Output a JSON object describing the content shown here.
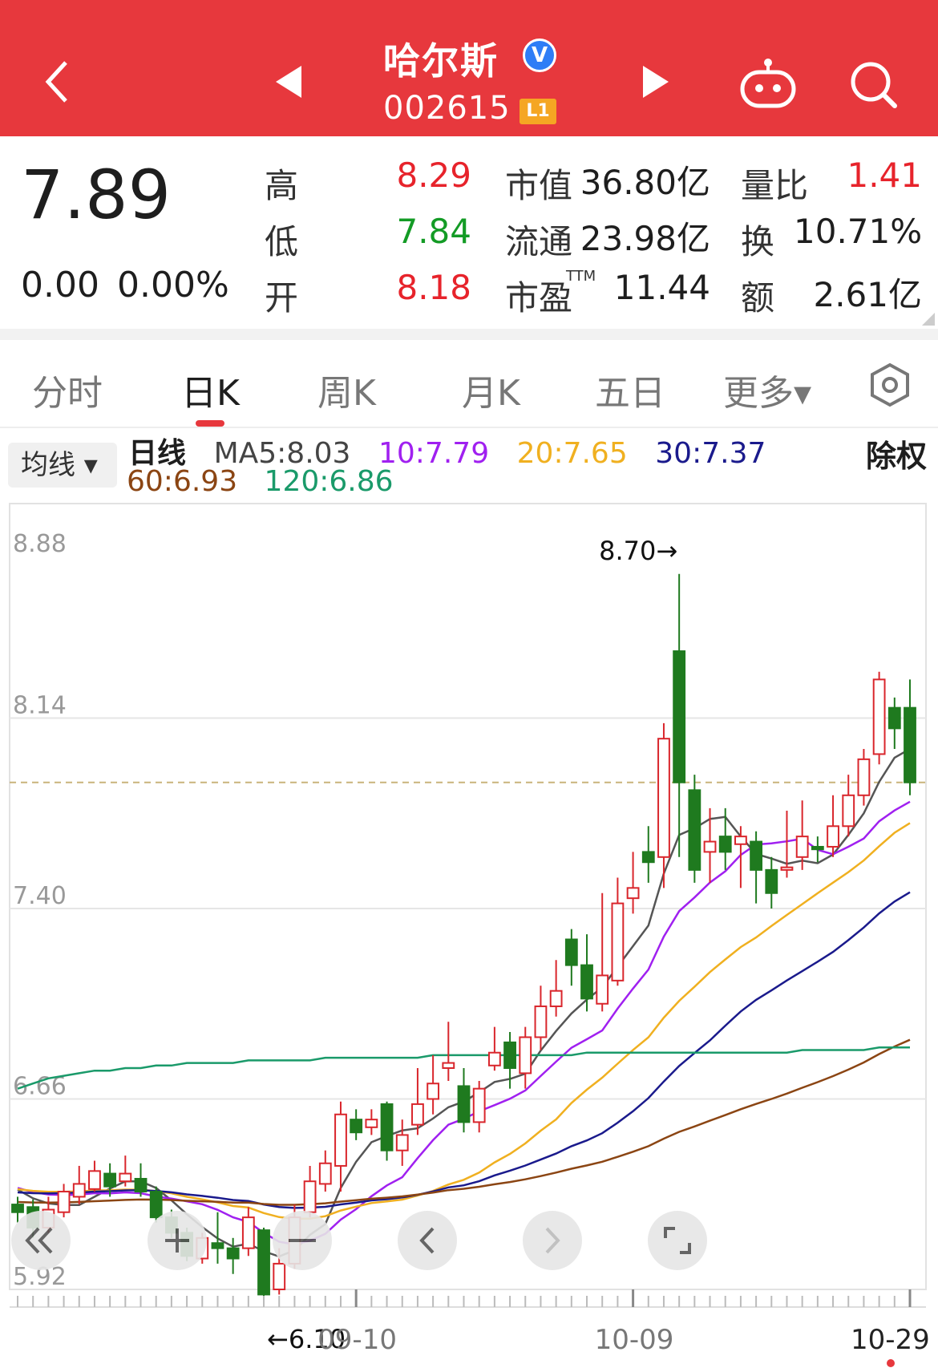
{
  "header": {
    "stock_name": "哈尔斯",
    "stock_code": "002615",
    "level_badge": "L1",
    "verified_badge": "V",
    "icons": [
      "back-icon",
      "prev-stock-icon",
      "next-stock-icon",
      "robot-icon",
      "search-icon"
    ]
  },
  "quote": {
    "price": "7.89",
    "change": "0.00",
    "change_pct": "0.00%",
    "rows": [
      [
        {
          "label": "高",
          "value": "8.29",
          "color": "red"
        },
        {
          "label": "市值",
          "value": "36.80亿",
          "color": "dark"
        },
        {
          "label": "量比",
          "value": "1.41",
          "color": "red"
        }
      ],
      [
        {
          "label": "低",
          "value": "7.84",
          "color": "green"
        },
        {
          "label": "流通",
          "value": "23.98亿",
          "color": "dark"
        },
        {
          "label": "换",
          "value": "10.71%",
          "color": "dark"
        }
      ],
      [
        {
          "label": "开",
          "value": "8.18",
          "color": "red"
        },
        {
          "label": "市盈",
          "value": "11.44",
          "color": "dark"
        },
        {
          "label": "额",
          "value": "2.61亿",
          "color": "dark"
        }
      ]
    ],
    "ttm": "TTM"
  },
  "tabs": [
    "分时",
    "日K",
    "周K",
    "月K",
    "五日",
    "更多▾"
  ],
  "active_tab": 1,
  "ma_selector": "均线 ▾",
  "ma_legend": {
    "row1": [
      {
        "text": "日线",
        "color": "#1e1e1e"
      },
      {
        "text": "MA5:8.03",
        "color": "#444444"
      },
      {
        "text": "10:7.79",
        "color": "#a020f0"
      },
      {
        "text": "20:7.65",
        "color": "#f0b020"
      },
      {
        "text": "30:7.37",
        "color": "#1a1a8c"
      }
    ],
    "row2": [
      {
        "text": "60:6.93",
        "color": "#8b4513"
      },
      {
        "text": "120:6.86",
        "color": "#1a9a6a"
      }
    ]
  },
  "chuquan": "除权",
  "chart_data": {
    "type": "candlestick",
    "y_axis_labels": [
      "8.88",
      "8.14",
      "7.40",
      "6.66",
      "5.92"
    ],
    "ylim": [
      5.92,
      8.88
    ],
    "x_labels": [
      "09-10",
      "10-09",
      "10-29"
    ],
    "high_annotation": "8.70→",
    "low_annotation": "←6.10",
    "last_price_line": 7.89,
    "colors": {
      "up": "#d9262c",
      "down": "#1f7a1f"
    },
    "candles": [
      [
        6.25,
        6.22,
        6.28,
        6.18
      ],
      [
        6.24,
        6.16,
        6.27,
        6.12
      ],
      [
        6.16,
        6.23,
        6.28,
        6.14
      ],
      [
        6.22,
        6.3,
        6.33,
        6.2
      ],
      [
        6.28,
        6.33,
        6.4,
        6.25
      ],
      [
        6.31,
        6.38,
        6.42,
        6.3
      ],
      [
        6.37,
        6.32,
        6.41,
        6.28
      ],
      [
        6.34,
        6.37,
        6.44,
        6.32
      ],
      [
        6.35,
        6.3,
        6.41,
        6.28
      ],
      [
        6.3,
        6.2,
        6.32,
        6.18
      ],
      [
        6.2,
        6.14,
        6.23,
        6.12
      ],
      [
        6.14,
        6.05,
        6.16,
        6.03
      ],
      [
        6.04,
        6.12,
        6.14,
        6.02
      ],
      [
        6.1,
        6.08,
        6.22,
        6.02
      ],
      [
        6.08,
        6.04,
        6.12,
        5.98
      ],
      [
        6.08,
        6.2,
        6.24,
        6.05
      ],
      [
        6.15,
        5.9,
        6.16,
        5.88
      ],
      [
        5.92,
        6.02,
        6.08,
        5.9
      ],
      [
        6.02,
        6.2,
        6.25,
        6.0
      ],
      [
        6.22,
        6.34,
        6.4,
        6.2
      ],
      [
        6.33,
        6.41,
        6.46,
        6.3
      ],
      [
        6.4,
        6.6,
        6.65,
        6.3
      ],
      [
        6.58,
        6.53,
        6.62,
        6.5
      ],
      [
        6.55,
        6.58,
        6.62,
        6.52
      ],
      [
        6.64,
        6.46,
        6.65,
        6.42
      ],
      [
        6.46,
        6.52,
        6.58,
        6.4
      ],
      [
        6.56,
        6.64,
        6.78,
        6.52
      ],
      [
        6.66,
        6.72,
        6.83,
        6.6
      ],
      [
        6.78,
        6.8,
        6.96,
        6.73
      ],
      [
        6.71,
        6.57,
        6.78,
        6.53
      ],
      [
        6.57,
        6.7,
        6.73,
        6.53
      ],
      [
        6.79,
        6.84,
        6.94,
        6.77
      ],
      [
        6.88,
        6.78,
        6.92,
        6.7
      ],
      [
        6.76,
        6.9,
        6.94,
        6.7
      ],
      [
        6.9,
        7.02,
        7.1,
        6.85
      ],
      [
        7.02,
        7.08,
        7.2,
        6.98
      ],
      [
        7.28,
        7.18,
        7.32,
        7.1
      ],
      [
        7.18,
        7.05,
        7.3,
        7.0
      ],
      [
        7.03,
        7.14,
        7.46,
        7.0
      ],
      [
        7.12,
        7.42,
        7.52,
        7.1
      ],
      [
        7.44,
        7.48,
        7.62,
        7.38
      ],
      [
        7.62,
        7.58,
        7.72,
        7.5
      ],
      [
        7.6,
        8.06,
        8.12,
        7.48
      ],
      [
        8.4,
        7.89,
        8.7,
        7.6
      ],
      [
        7.86,
        7.55,
        7.92,
        7.5
      ],
      [
        7.62,
        7.66,
        7.79,
        7.5
      ],
      [
        7.68,
        7.62,
        7.79,
        7.55
      ],
      [
        7.65,
        7.68,
        7.72,
        7.48
      ],
      [
        7.66,
        7.55,
        7.7,
        7.42
      ],
      [
        7.55,
        7.46,
        7.6,
        7.4
      ],
      [
        7.55,
        7.56,
        7.78,
        7.52
      ],
      [
        7.6,
        7.68,
        7.82,
        7.55
      ],
      [
        7.64,
        7.63,
        7.68,
        7.58
      ],
      [
        7.64,
        7.72,
        7.84,
        7.6
      ],
      [
        7.72,
        7.84,
        7.92,
        7.68
      ],
      [
        7.84,
        7.98,
        8.02,
        7.8
      ],
      [
        8.0,
        8.29,
        8.32,
        7.96
      ],
      [
        8.18,
        8.1,
        8.22,
        8.02
      ],
      [
        8.18,
        7.89,
        8.29,
        7.84
      ]
    ],
    "series": [
      {
        "name": "MA5",
        "color": "#555555"
      },
      {
        "name": "MA10",
        "color": "#a020f0"
      },
      {
        "name": "MA20",
        "color": "#f0b020"
      },
      {
        "name": "MA30",
        "color": "#1a1a8c"
      },
      {
        "name": "MA60",
        "color": "#8b4513"
      },
      {
        "name": "MA120",
        "color": "#1a9a6a",
        "values": [
          6.7,
          6.72,
          6.74,
          6.75,
          6.76,
          6.77,
          6.77,
          6.78,
          6.78,
          6.79,
          6.79,
          6.8,
          6.8,
          6.8,
          6.8,
          6.81,
          6.81,
          6.81,
          6.81,
          6.81,
          6.82,
          6.82,
          6.82,
          6.82,
          6.82,
          6.82,
          6.82,
          6.83,
          6.83,
          6.83,
          6.83,
          6.83,
          6.83,
          6.83,
          6.83,
          6.83,
          6.83,
          6.84,
          6.84,
          6.84,
          6.84,
          6.84,
          6.84,
          6.84,
          6.84,
          6.84,
          6.84,
          6.84,
          6.84,
          6.84,
          6.84,
          6.85,
          6.85,
          6.85,
          6.85,
          6.85,
          6.86,
          6.86,
          6.86
        ]
      }
    ]
  },
  "nav_buttons": [
    "rewind-button",
    "zoom-in-button",
    "zoom-out-button",
    "prev-button",
    "next-button",
    "fullscreen-button"
  ]
}
